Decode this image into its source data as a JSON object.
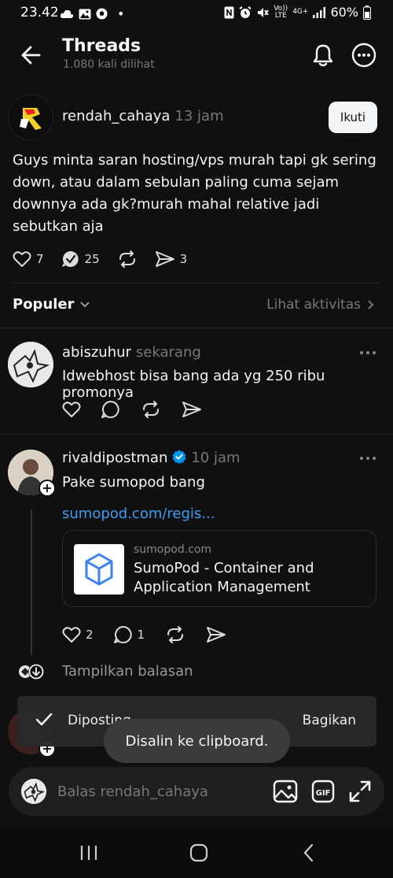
{
  "status_bar": {
    "time": "23.42",
    "dot": "•",
    "volte": "Vo)) LTE",
    "network": "4G+",
    "battery": "60%"
  },
  "header": {
    "title": "Threads",
    "views": "1.080 kali dilihat"
  },
  "post": {
    "username": "rendah_cahaya",
    "time": "13 jam",
    "follow_label": "Ikuti",
    "text": "Guys minta saran hosting/vps murah tapi gk sering down, atau dalam sebulan paling cuma sejam downnya ada gk?murah mahal relative jadi sebutkan aja",
    "likes": "7",
    "replies": "25",
    "shares": "3"
  },
  "sort": {
    "label": "Populer",
    "activity_label": "Lihat aktivitas"
  },
  "replies": [
    {
      "username": "abiszuhur",
      "time": "sekarang",
      "text": "Idwebhost bisa bang ada yg 250 ribu promonya"
    },
    {
      "username": "rivaldipostman",
      "time": "10 jam",
      "text": "Pake sumopod bang",
      "link_text": "sumopod.com/regis...",
      "link_domain": "sumopod.com",
      "link_title": "SumoPod - Container and Application Management",
      "likes": "2",
      "comments": "1",
      "show_replies_label": "Tampilkan balasan"
    }
  ],
  "snackbar": {
    "text": "Diposting",
    "action": "Bagikan"
  },
  "toast": {
    "text": "Disalin ke clipboard."
  },
  "reply_bar": {
    "placeholder": "Balas rendah_cahaya",
    "gif_label": "GIF"
  },
  "colors": {
    "background": "#101010",
    "link": "#3a9ef2",
    "verified": "#0095f6"
  }
}
